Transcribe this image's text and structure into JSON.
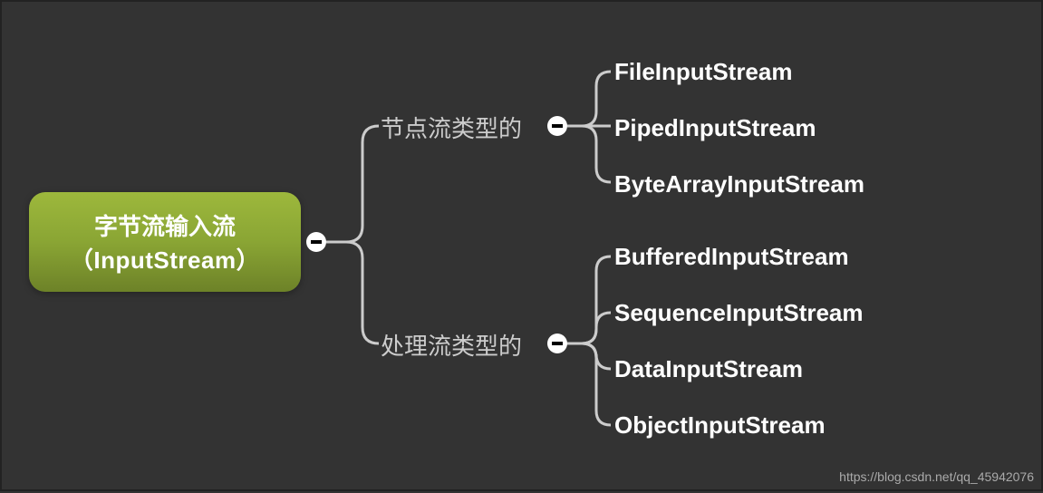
{
  "root": {
    "line1": "字节流输入流",
    "line2": "（InputStream）"
  },
  "branches": {
    "b1_label": "节点流类型的",
    "b2_label": "处理流类型的"
  },
  "leaves": {
    "l1": "FileInputStream",
    "l2": "PipedInputStream",
    "l3": "ByteArrayInputStream",
    "l4": "BufferedInputStream",
    "l5": "SequenceInputStream",
    "l6": "DataInputStream",
    "l7": "ObjectInputStream"
  },
  "watermark": "https://blog.csdn.net/qq_45942076",
  "chart_data": {
    "type": "tree",
    "root": "字节流输入流（InputStream）",
    "children": [
      {
        "label": "节点流类型的",
        "children": [
          "FileInputStream",
          "PipedInputStream",
          "ByteArrayInputStream"
        ]
      },
      {
        "label": "处理流类型的",
        "children": [
          "BufferedInputStream",
          "SequenceInputStream",
          "DataInputStream",
          "ObjectInputStream"
        ]
      }
    ]
  }
}
